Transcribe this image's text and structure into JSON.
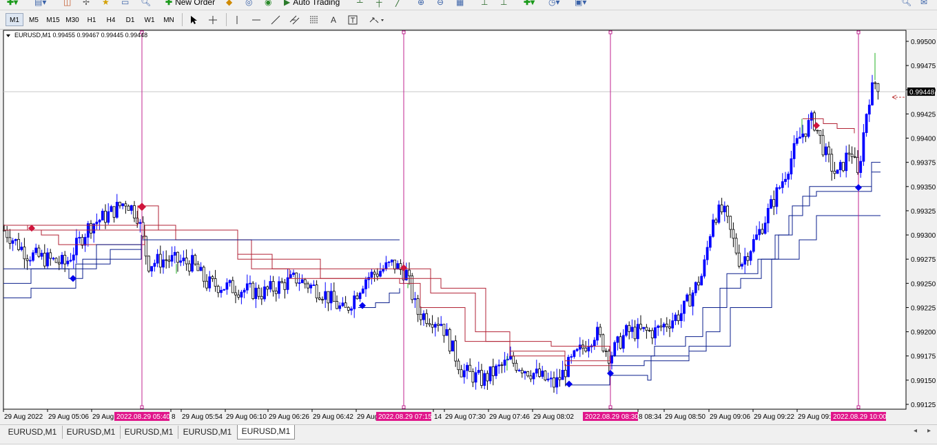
{
  "toolbar": {
    "new_order_label": "New Order",
    "auto_trading_label": "Auto Trading"
  },
  "timeframes": [
    "M1",
    "M5",
    "M15",
    "M30",
    "H1",
    "H4",
    "D1",
    "W1",
    "MN"
  ],
  "active_timeframe": "M1",
  "chart": {
    "header": "EURUSD,M1  0.99455 0.99467 0.99445 0.99448",
    "current_price_label": "0.99448",
    "y_ticks": [
      "0.99500",
      "0.99475",
      "0.99450",
      "0.99425",
      "0.99400",
      "0.99375",
      "0.99350",
      "0.99325",
      "0.99300",
      "0.99275",
      "0.99250",
      "0.99225",
      "0.99200",
      "0.99175",
      "0.99150",
      "0.99125"
    ],
    "x_ticks": [
      "29 Aug 2022",
      "29 Aug 05:06",
      "29 Aug",
      "8",
      "29 Aug 05:54",
      "29 Aug 06:10",
      "29 Aug 06:26",
      "29 Aug 06:42",
      "29 Aug",
      "14",
      "29 Aug 07:30",
      "29 Aug 07:46",
      "29 Aug 08:02",
      "8 08:34",
      "29 Aug 08:50",
      "29 Aug 09:06",
      "29 Aug 09:22",
      "29 Aug 09:"
    ],
    "marker_labels": [
      "2022.08.29 05:40",
      "2022.08.29 07:15",
      "2022.08.29 08:30",
      "2022.08.29 10:00"
    ],
    "colors": {
      "background": "#ffffff",
      "bull_candle": "#0000ff",
      "bear_candle": "#000000",
      "vline": "#c0208f",
      "red_line": "#b22234",
      "blue_line": "#0a1e8c",
      "marker_label_bg": "#e0158a",
      "price_label_bg": "#000000"
    }
  },
  "tabs": [
    "EURUSD,M1",
    "EURUSD,M1",
    "EURUSD,M1",
    "EURUSD,M1",
    "EURUSD,M1"
  ],
  "active_tab": 4
}
